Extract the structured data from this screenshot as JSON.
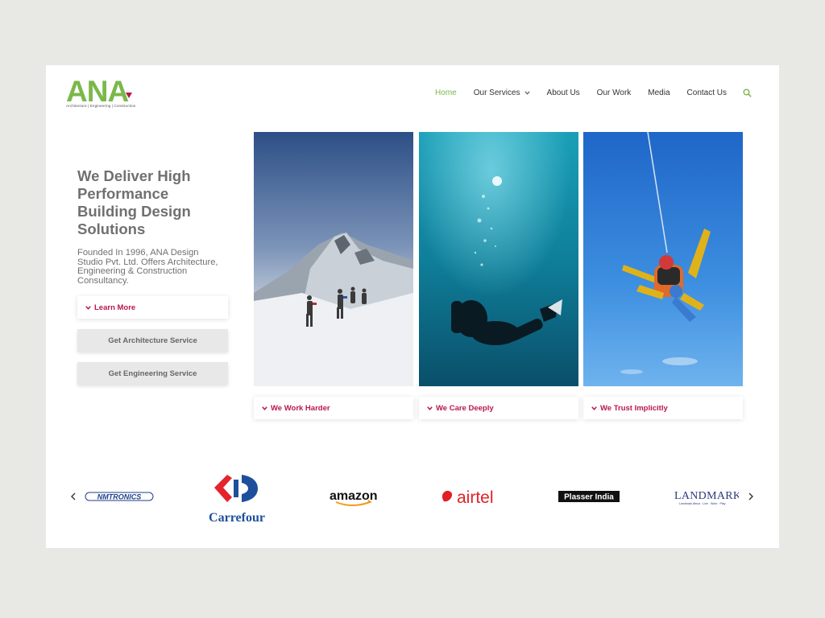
{
  "brand": {
    "logo_text": "ANA",
    "tagline": "Architecture  |  Engineering  |  Construction",
    "accent": "#7bb84a",
    "accent_pink": "#b8174e"
  },
  "nav": {
    "items": [
      {
        "label": "Home",
        "active": true
      },
      {
        "label": "Our Services",
        "has_dropdown": true
      },
      {
        "label": "About Us"
      },
      {
        "label": "Our Work"
      },
      {
        "label": "Media"
      },
      {
        "label": "Contact Us"
      }
    ],
    "search_icon": "search-icon"
  },
  "hero": {
    "title": "We Deliver High Performance Building Design Solutions",
    "description": "Founded In 1996, ANA Design Studio Pvt. Ltd. Offers Architecture, Engineering & Construction Consultancy.",
    "learn_more": "Learn More",
    "btn_architecture": "Get Architecture Service",
    "btn_engineering": "Get Engineering Service"
  },
  "panels": [
    {
      "caption": "We Work Harder"
    },
    {
      "caption": "We Care Deeply"
    },
    {
      "caption": "We Trust Implicitly"
    }
  ],
  "clients": {
    "nmtronics": "NMTRONICS",
    "carrefour": "Carrefour",
    "amazon": "amazon",
    "airtel": "airtel",
    "plasser": "Plasser India",
    "landmark": "LANDMARK",
    "landmark_tag": "Landmark Africa · Live · Work · Play"
  }
}
